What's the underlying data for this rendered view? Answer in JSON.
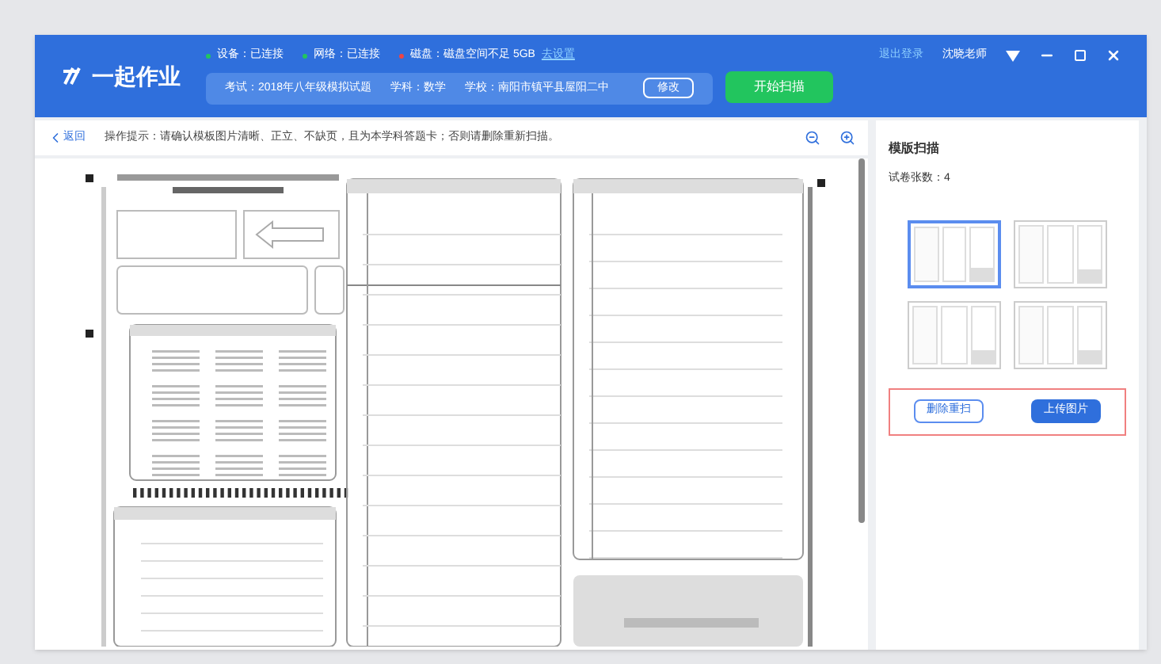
{
  "app": {
    "name": "一起作业"
  },
  "status": [
    {
      "label": "设备：已连接",
      "color": "#22c55e"
    },
    {
      "label": "网络：已连接",
      "color": "#22c55e"
    },
    {
      "label": "磁盘：磁盘空间不足 5GB",
      "color": "#ef4444"
    }
  ],
  "status_link": "去设置",
  "exam_info": [
    "考试：2018年八年级模拟试题",
    "学科：数学",
    "学校：南阳市镇平县屋阳二中"
  ],
  "edit_button": "修改",
  "scan_button": "开始扫描",
  "logout": "退出登录",
  "user": "沈晓老师",
  "toolbar": {
    "back": "返回",
    "hint": "操作提示：请确认模板图片清晰、正立、不缺页，且为本学科答题卡；否则请删除重新扫描。"
  },
  "panel": {
    "title": "模版扫描",
    "count": "试卷张数：4",
    "thumbnails": [
      {
        "selected": true
      },
      {
        "selected": false
      },
      {
        "selected": false
      },
      {
        "selected": false
      }
    ],
    "buttons": [
      "删除重扫",
      "上传图片"
    ]
  }
}
